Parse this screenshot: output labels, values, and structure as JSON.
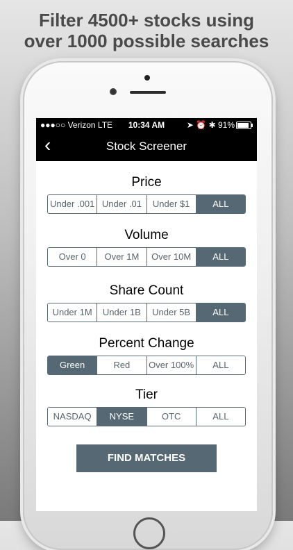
{
  "headline": {
    "line1": "Filter 4500+ stocks using",
    "line2": "over 1000 possible searches"
  },
  "status_bar": {
    "carrier": "●●●○○ Verizon  LTE",
    "time": "10:34 AM",
    "icons": "➤ ⏰ ✱ 91%",
    "battery_level": 0.91
  },
  "nav": {
    "back_icon": "‹",
    "title": "Stock Screener"
  },
  "filters": [
    {
      "label": "Price",
      "options": [
        "Under .001",
        "Under .01",
        "Under $1",
        "ALL"
      ],
      "selected": 3
    },
    {
      "label": "Volume",
      "options": [
        "Over 0",
        "Over 1M",
        "Over 10M",
        "ALL"
      ],
      "selected": 3
    },
    {
      "label": "Share Count",
      "options": [
        "Under 1M",
        "Under 1B",
        "Under 5B",
        "ALL"
      ],
      "selected": 3
    },
    {
      "label": "Percent Change",
      "options": [
        "Green",
        "Red",
        "Over 100%",
        "ALL"
      ],
      "selected": 0
    },
    {
      "label": "Tier",
      "options": [
        "NASDAQ",
        "NYSE",
        "OTC",
        "ALL"
      ],
      "selected": 1
    }
  ],
  "find_button": "FIND MATCHES",
  "colors": {
    "accent": "#566873",
    "bar": "#000000"
  }
}
